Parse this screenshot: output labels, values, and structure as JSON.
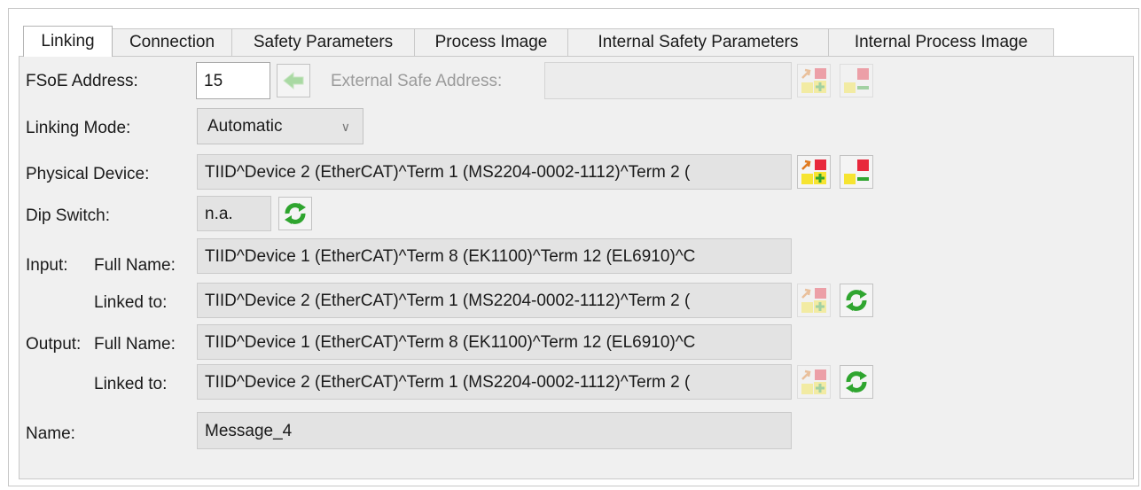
{
  "tabs": [
    {
      "label": "Linking",
      "active": true
    },
    {
      "label": "Connection",
      "active": false
    },
    {
      "label": "Safety Parameters",
      "active": false
    },
    {
      "label": "Process Image",
      "active": false
    },
    {
      "label": "Internal Safety Parameters",
      "active": false
    },
    {
      "label": "Internal Process Image",
      "active": false
    }
  ],
  "fsoe": {
    "label": "FSoE Address:",
    "value": "15",
    "external_label": "External Safe Address:",
    "external_value": ""
  },
  "linking_mode": {
    "label": "Linking Mode:",
    "value": "Automatic"
  },
  "physical_device": {
    "label": "Physical Device:",
    "value": "TIID^Device 2 (EtherCAT)^Term 1 (MS2204-0002-1112)^Term 2 ("
  },
  "dip_switch": {
    "label": "Dip Switch:",
    "value": "n.a."
  },
  "input": {
    "section_label": "Input:",
    "full_name_label": "Full Name:",
    "full_name": "TIID^Device 1 (EtherCAT)^Term 8 (EK1100)^Term 12 (EL6910)^C",
    "linked_label": "Linked to:",
    "linked_to": "TIID^Device 2 (EtherCAT)^Term 1 (MS2204-0002-1112)^Term 2 ("
  },
  "output": {
    "section_label": "Output:",
    "full_name_label": "Full Name:",
    "full_name": "TIID^Device 1 (EtherCAT)^Term 8 (EK1100)^Term 12 (EL6910)^C",
    "linked_label": "Linked to:",
    "linked_to": "TIID^Device 2 (EtherCAT)^Term 1 (MS2204-0002-1112)^Term 2 ("
  },
  "name": {
    "label": "Name:",
    "value": "Message_4"
  },
  "icons": {
    "arrow": "left-arrow-icon",
    "link": "link-device-icon",
    "unlink": "unlink-device-icon",
    "refresh": "refresh-icon"
  },
  "colors": {
    "panel": "#f0f0f0",
    "field": "#e3e3e3",
    "icon_red": "#e8283c",
    "icon_yellow": "#f6e431",
    "icon_green": "#2fa52f"
  }
}
